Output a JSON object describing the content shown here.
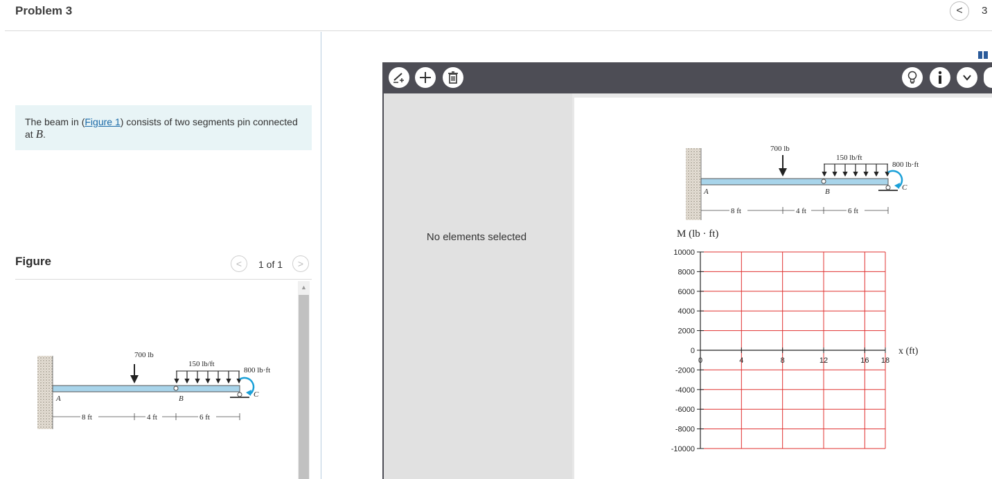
{
  "header": {
    "title": "Problem 3",
    "nav_prev": "<",
    "counter": "3"
  },
  "prompt": {
    "text_before": "The beam in (",
    "link": "Figure 1",
    "text_after": ") consists of two segments pin connected at ",
    "point": "B",
    "period": "."
  },
  "figure_panel": {
    "label": "Figure",
    "prev": "<",
    "count": "1 of 1",
    "next": ">"
  },
  "beam_figure": {
    "point_load": "700 lb",
    "distributed_load": "150 lb/ft",
    "moment": "800 lb·ft",
    "point_a": "A",
    "point_b": "B",
    "point_c": "C",
    "dim_1": "8 ft",
    "dim_2": "4 ft",
    "dim_3": "6 ft"
  },
  "toolbar": {
    "draw_icon": "pencil-plus-icon",
    "add_icon": "plus-icon",
    "delete_icon": "trash-icon",
    "hint_icon": "lightbulb-icon",
    "info_icon": "info-icon",
    "menu_icon": "chevron-down-icon"
  },
  "tool_panel": {
    "status": "No elements selected"
  },
  "colors": {
    "grid_red": "#e0302f",
    "beam_blue": "#a8d4ea",
    "toolbar": "#4d4d55",
    "prompt_bg": "#e8f4f6",
    "moment_arrow": "#1aa0d8"
  },
  "chart_data": {
    "type": "line",
    "ylabel": "M (lb · ft)",
    "xlabel": "x (ft)",
    "xlim": [
      0,
      18
    ],
    "ylim": [
      -10000,
      10000
    ],
    "x_ticks": [
      "0",
      "4",
      "8",
      "12",
      "16",
      "18"
    ],
    "y_ticks": [
      "10000",
      "8000",
      "6000",
      "4000",
      "2000",
      "0",
      "-2000",
      "-4000",
      "-6000",
      "-8000",
      "-10000"
    ],
    "grid": true,
    "series": []
  }
}
